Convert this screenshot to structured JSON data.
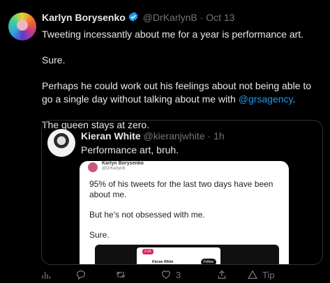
{
  "tweet": {
    "name": "Karlyn Borysenko",
    "handle": "@DrKarlynB",
    "separator": "·",
    "date": "Oct 13",
    "line1": "Tweeting incessantly about me for a year is performance art.",
    "line2": "Sure.",
    "line3_pre": "Perhaps he could work out his feelings about not being able to go a single day without talking about me with ",
    "line3_mention": "@grsagency",
    "line3_post": ".",
    "line4": "The queen stays at zero."
  },
  "quote": {
    "name": "Kieran White",
    "handle": "@kieranjwhite",
    "separator": "·",
    "date": "1h",
    "text": "Performance art, bruh."
  },
  "screenshot": {
    "name": "Karlyn Borysenko",
    "handle": "@DrKarlynB",
    "line1": "95% of his tweets for the last two days have been about me.",
    "line2": "But he's not obsessed with me.",
    "line3": "Sure.",
    "phone_time": "2:16",
    "phone_name": "Kieran White",
    "phone_follow": "Follow"
  },
  "actions": {
    "like_count": "3",
    "tip_label": "Tip"
  },
  "colors": {
    "background": "#000000",
    "text": "#e7e9ea",
    "muted": "#71767b",
    "link": "#1d9bf0",
    "border": "#2f3336"
  },
  "icons": [
    "verified-badge-icon",
    "analytics-icon",
    "reply-icon",
    "retweet-icon",
    "like-icon",
    "share-icon",
    "tip-icon"
  ]
}
